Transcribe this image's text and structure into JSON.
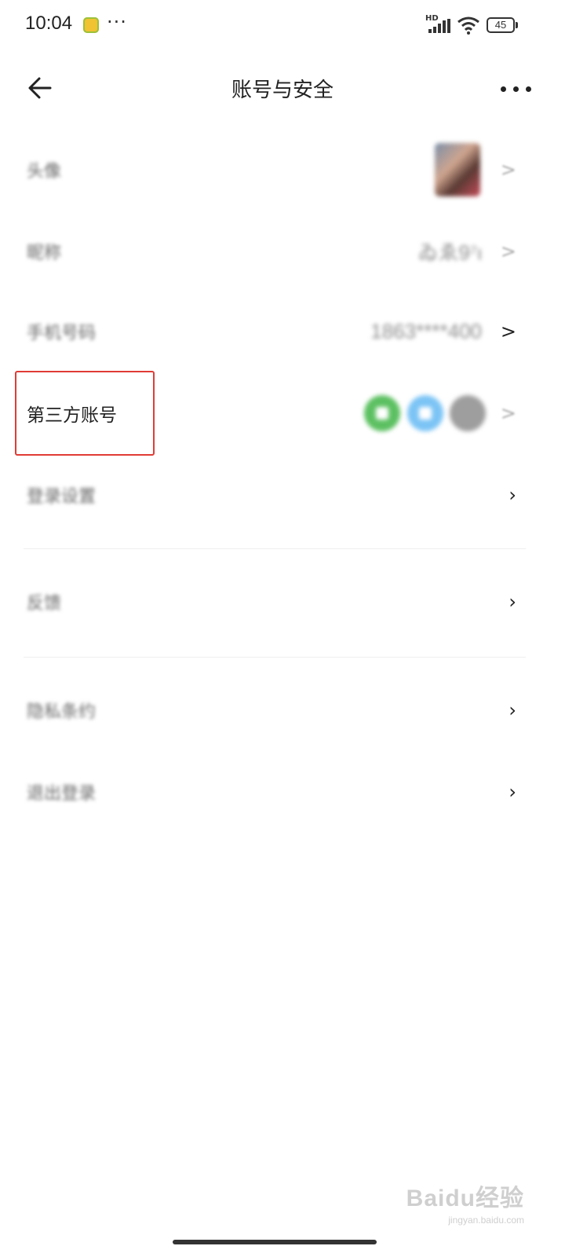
{
  "status_bar": {
    "time": "10:04",
    "app_icon": "notification-app-icon",
    "more": "···",
    "hd_badge": "HD",
    "battery": "45"
  },
  "header": {
    "title": "账号与安全",
    "back_icon": "arrow-left-icon",
    "more_icon": "more-dots-icon"
  },
  "rows": {
    "avatar": {
      "label": "头像",
      "chevron": ">"
    },
    "nickname": {
      "label": "昵称",
      "value": "ゐゑ9⁷ι",
      "chevron": ">"
    },
    "phone": {
      "label": "手机号码",
      "value": "1863****400",
      "chevron": ">"
    },
    "third_party": {
      "label": "第三方账号",
      "icons": [
        "wechat-icon",
        "qq-icon",
        "weibo-icon"
      ],
      "chevron": ">"
    },
    "login_settings": {
      "label": "登录设置",
      "chevron": "›"
    },
    "feedback": {
      "label": "反馈",
      "chevron": "›"
    },
    "privacy": {
      "label": "隐私条约",
      "chevron": "›"
    },
    "logout": {
      "label": "退出登录",
      "chevron": "›"
    }
  },
  "highlight_color": "#e03c36",
  "watermark": {
    "logo": "Baidu经验",
    "url": "jingyan.baidu.com"
  }
}
